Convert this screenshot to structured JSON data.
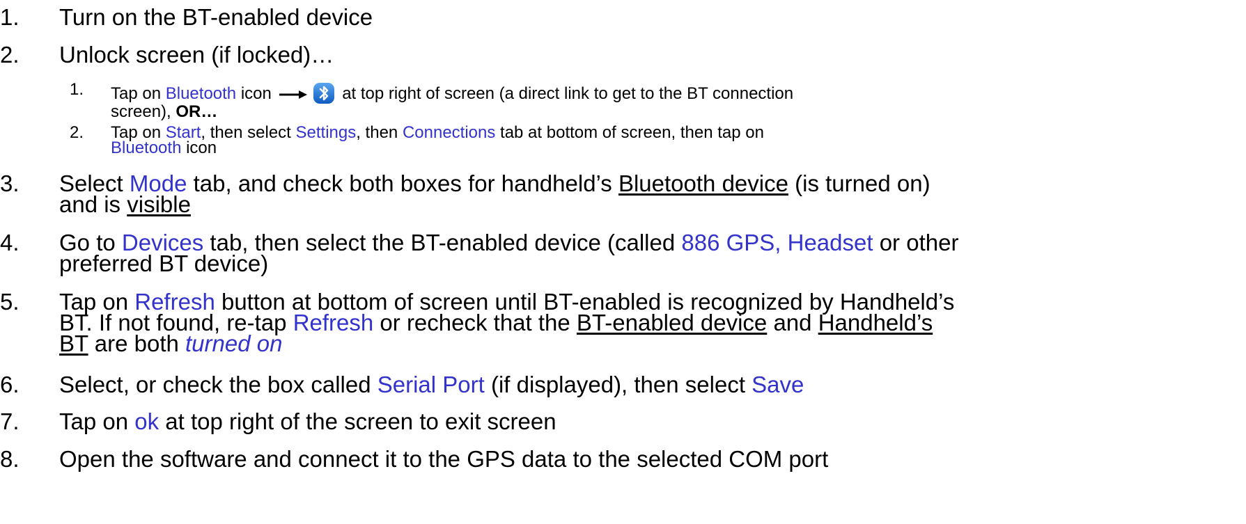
{
  "steps": [
    {
      "num": "1.",
      "text": "Turn on the BT-enabled device"
    },
    {
      "num": "2.",
      "text": "Unlock screen (if locked)…",
      "substeps": [
        {
          "num": "1.",
          "tap_on": "Tap on ",
          "bluetooth": "Bluetooth",
          "icon_word": " icon ",
          "rest1": " at top right of screen (a direct link to get to the BT connection",
          "rest2": "screen), ",
          "or": "OR…"
        },
        {
          "num": "2.",
          "tap_on": "Tap on ",
          "start": "Start",
          "then_select": ", then select ",
          "settings": "Settings",
          "then": ", then ",
          "connections": "Connections",
          "rest1": " tab at bottom of screen, then tap on",
          "bluetooth": "Bluetooth",
          "icon_word": " icon"
        }
      ]
    },
    {
      "num": "3.",
      "select": "Select ",
      "mode": "Mode",
      "rest1": " tab, and check both boxes for handheld’s ",
      "bt_device": "Bluetooth device",
      "rest2": " (is turned on)",
      "rest3": "and is ",
      "visible": "visible"
    },
    {
      "num": "4.",
      "go_to": "Go to ",
      "devices": "Devices",
      "rest1": " tab, then select the BT-enabled device (called ",
      "names": "886 GPS, Headset",
      "rest2": " or other",
      "rest3": "preferred BT device)"
    },
    {
      "num": "5.",
      "tap_on": "Tap on ",
      "refresh": "Refresh",
      "rest1": " button at bottom of screen until BT-enabled is recognized by Handheld’s",
      "rest2": "BT. If not found, re-tap ",
      "refresh2": "Refresh",
      "rest3": " or recheck that the ",
      "bt_enabled_device": "BT-enabled device",
      "and": " and ",
      "handhelds": "Handheld’s",
      "bt": "BT",
      "are_both": " are both ",
      "turned_on": "turned on"
    },
    {
      "num": "6.",
      "text1": "Select, or check the box called ",
      "serial_port": "Serial Port",
      "text2": " (if displayed), then select ",
      "save": "Save"
    },
    {
      "num": "7.",
      "text1": "Tap on ",
      "ok": "ok",
      "text2": " at top right of the screen to exit screen"
    },
    {
      "num": "8.",
      "text": "Open the software and connect it to the GPS data to the selected COM port"
    }
  ],
  "colors": {
    "link_blue": "#3333cc",
    "text": "#000000",
    "bluetooth_icon": "#1f73d6"
  },
  "icons": {
    "arrow": "right-arrow-icon",
    "bluetooth": "bluetooth-icon"
  }
}
